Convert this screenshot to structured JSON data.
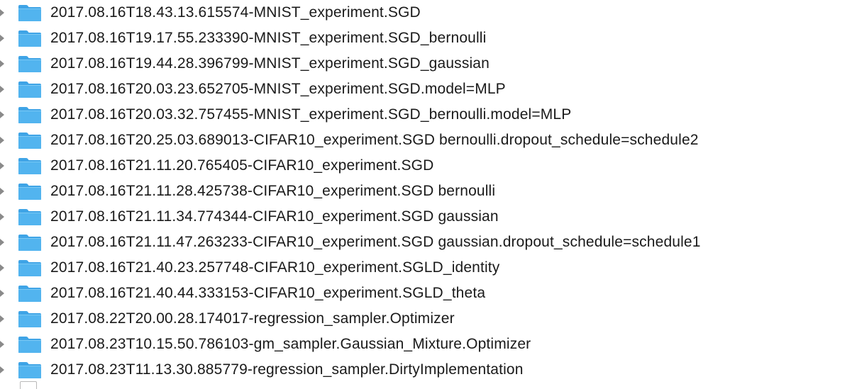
{
  "finder": {
    "rows": [
      {
        "name": "2017.08.16T18.43.13.615574-MNIST_experiment.SGD",
        "icon": "folder-icon"
      },
      {
        "name": "2017.08.16T19.17.55.233390-MNIST_experiment.SGD_bernoulli",
        "icon": "folder-icon"
      },
      {
        "name": "2017.08.16T19.44.28.396799-MNIST_experiment.SGD_gaussian",
        "icon": "folder-icon"
      },
      {
        "name": "2017.08.16T20.03.23.652705-MNIST_experiment.SGD.model=MLP",
        "icon": "folder-icon"
      },
      {
        "name": "2017.08.16T20.03.32.757455-MNIST_experiment.SGD_bernoulli.model=MLP",
        "icon": "folder-icon"
      },
      {
        "name": "2017.08.16T20.25.03.689013-CIFAR10_experiment.SGD bernoulli.dropout_schedule=schedule2",
        "icon": "folder-icon"
      },
      {
        "name": "2017.08.16T21.11.20.765405-CIFAR10_experiment.SGD",
        "icon": "folder-icon"
      },
      {
        "name": "2017.08.16T21.11.28.425738-CIFAR10_experiment.SGD bernoulli",
        "icon": "folder-icon"
      },
      {
        "name": "2017.08.16T21.11.34.774344-CIFAR10_experiment.SGD gaussian",
        "icon": "folder-icon"
      },
      {
        "name": "2017.08.16T21.11.47.263233-CIFAR10_experiment.SGD gaussian.dropout_schedule=schedule1",
        "icon": "folder-icon"
      },
      {
        "name": "2017.08.16T21.40.23.257748-CIFAR10_experiment.SGLD_identity",
        "icon": "folder-icon"
      },
      {
        "name": "2017.08.16T21.40.44.333153-CIFAR10_experiment.SGLD_theta",
        "icon": "folder-icon"
      },
      {
        "name": "2017.08.22T20.00.28.174017-regression_sampler.Optimizer",
        "icon": "folder-icon"
      },
      {
        "name": "2017.08.23T10.15.50.786103-gm_sampler.Gaussian_Mixture.Optimizer",
        "icon": "folder-icon"
      },
      {
        "name": "2017.08.23T11.13.30.885779-regression_sampler.DirtyImplementation",
        "icon": "folder-icon"
      }
    ],
    "colors": {
      "folder_body": "#52b4ef",
      "folder_tab": "#3fa4e6",
      "folder_shadow": "#2f95db",
      "text": "#1a1a1a",
      "disclosure": "#8a8a8a"
    }
  }
}
